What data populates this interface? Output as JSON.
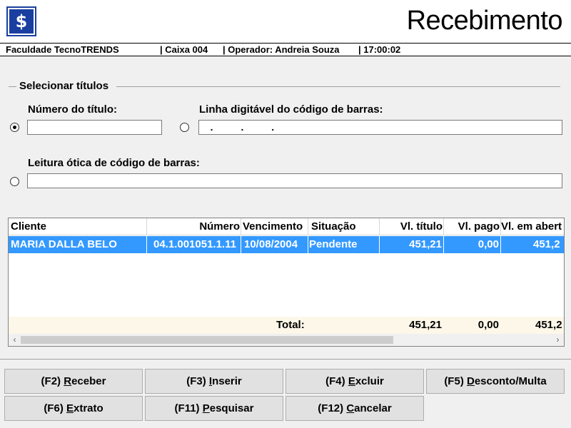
{
  "header": {
    "logo_symbol": "$",
    "title": "Recebimento"
  },
  "status": {
    "institution": "Faculdade TecnoTRENDS",
    "caixa": "| Caixa 004",
    "operador": "| Operador: Andreia Souza",
    "time": "| 17:00:02"
  },
  "form": {
    "group_title": "Selecionar títulos",
    "numero_label": "Número do título:",
    "numero_value": "",
    "linha_label": "Linha digitável do código de barras:",
    "linha_value": "   .          .          .",
    "leitura_label": "Leitura ótica de código de barras:",
    "leitura_value": "",
    "selected_option": "numero"
  },
  "table": {
    "columns": [
      "Cliente",
      "Número",
      "Vencimento",
      "Situação",
      "Vl. título",
      "Vl. pago",
      "Vl. em abert"
    ],
    "rows": [
      {
        "cliente": "MARIA DALLA BELO",
        "numero": "04.1.001051.1.11",
        "vencimento": "10/08/2004",
        "situacao": "Pendente",
        "vl_titulo": "451,21",
        "vl_pago": "0,00",
        "vl_aberto": "451,2"
      }
    ],
    "total": {
      "label": "Total:",
      "vl_titulo": "451,21",
      "vl_pago": "0,00",
      "vl_aberto": "451,2"
    }
  },
  "buttons": {
    "receber": {
      "prefix": "(F2) ",
      "hotkey": "R",
      "rest": "eceber"
    },
    "inserir": {
      "prefix": "(F3) ",
      "hotkey": "I",
      "rest": "nserir"
    },
    "excluir": {
      "prefix": "(F4) ",
      "hotkey": "E",
      "rest": "xcluir"
    },
    "desconto": {
      "prefix": "(F5) ",
      "hotkey": "D",
      "rest": "esconto/Multa"
    },
    "extrato": {
      "prefix": "(F6) ",
      "hotkey": "E",
      "rest": "xtrato"
    },
    "pesquisar": {
      "prefix": "(F11) ",
      "hotkey": "P",
      "rest": "esquisar"
    },
    "cancelar": {
      "prefix": "(F12) ",
      "hotkey": "C",
      "rest": "ancelar"
    }
  },
  "colors": {
    "selection": "#3399ff",
    "logo": "#1a3fa0",
    "total_row": "#fdf7e9"
  }
}
